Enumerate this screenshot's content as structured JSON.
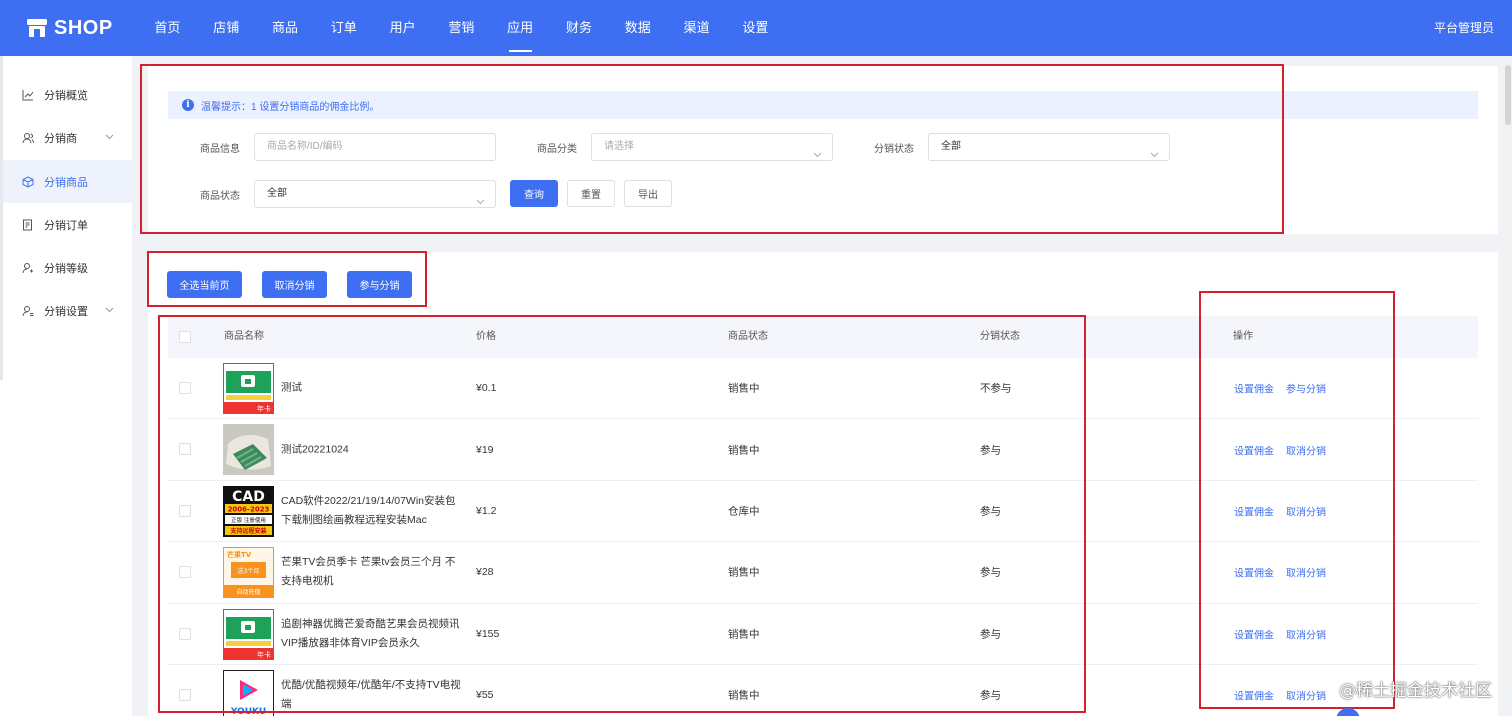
{
  "brand": {
    "name": "SHOP",
    "accent": "#3e6ff2"
  },
  "nav": {
    "items": [
      "首页",
      "店铺",
      "商品",
      "订单",
      "用户",
      "营销",
      "应用",
      "财务",
      "数据",
      "渠道",
      "设置"
    ],
    "active": "应用",
    "admin": "平台管理员"
  },
  "sidebar": {
    "items": [
      {
        "label": "分销概览",
        "icon": "chart-line-icon"
      },
      {
        "label": "分销商",
        "icon": "users-icon",
        "expandable": true
      },
      {
        "label": "分销商品",
        "icon": "box-icon",
        "active": true
      },
      {
        "label": "分销订单",
        "icon": "order-icon"
      },
      {
        "label": "分销等级",
        "icon": "level-icon"
      },
      {
        "label": "分销设置",
        "icon": "settings-icon",
        "expandable": true
      }
    ]
  },
  "tip": {
    "text": "温馨提示：1 设置分销商品的佣金比例。"
  },
  "filters": {
    "product_info": {
      "label": "商品信息",
      "placeholder": "商品名称/ID/编码"
    },
    "category": {
      "label": "商品分类",
      "placeholder": "请选择"
    },
    "dist_status": {
      "label": "分销状态",
      "value": "全部"
    },
    "product_status": {
      "label": "商品状态",
      "value": "全部"
    },
    "query": "查询",
    "reset": "重置",
    "export": "导出"
  },
  "actions": {
    "select_page": "全选当前页",
    "cancel_dist": "取消分销",
    "join_dist": "参与分销"
  },
  "table": {
    "headers": {
      "name": "商品名称",
      "price": "价格",
      "status": "商品状态",
      "dist": "分销状态",
      "ops": "操作"
    },
    "rows": [
      {
        "name": "测试",
        "price": "¥0.1",
        "status": "销售中",
        "dist": "不参与",
        "op1": "设置佣金",
        "op2": "参与分销",
        "thumb": "green-card"
      },
      {
        "name": "测试20221024",
        "price": "¥19",
        "status": "销售中",
        "dist": "参与",
        "op1": "设置佣金",
        "op2": "取消分销",
        "thumb": "cloth"
      },
      {
        "name": "CAD软件2022/21/19/14/07Win安装包下载制图绘画教程远程安装Mac",
        "price": "¥1.2",
        "status": "仓库中",
        "dist": "参与",
        "op1": "设置佣金",
        "op2": "取消分销",
        "thumb": "cad"
      },
      {
        "name": "芒果TV会员季卡 芒果tv会员三个月 不支持电视机",
        "price": "¥28",
        "status": "销售中",
        "dist": "参与",
        "op1": "设置佣金",
        "op2": "取消分销",
        "thumb": "mango"
      },
      {
        "name": "追剧神器优腾芒爱奇酷艺果会员视频讯VIP播放器非体育VIP会员永久",
        "price": "¥155",
        "status": "销售中",
        "dist": "参与",
        "op1": "设置佣金",
        "op2": "取消分销",
        "thumb": "green-card"
      },
      {
        "name": "优酷/优酷视频年/优酷年/不支持TV电视端",
        "price": "¥55",
        "status": "销售中",
        "dist": "参与",
        "op1": "设置佣金",
        "op2": "取消分销",
        "thumb": "youku"
      }
    ]
  },
  "thumb_text": {
    "card_label": "年卡",
    "cad_title": "CAD",
    "cad_years": "2006-2023",
    "cad_sub": "正版 注册使用",
    "cad_foot": "支持远程安装",
    "mango_brand": "芒果TV",
    "mango_mid": "送3个月",
    "mango_foot": "自动充值",
    "youku": "YOUKU"
  },
  "watermark": "@稀土掘金技术社区"
}
